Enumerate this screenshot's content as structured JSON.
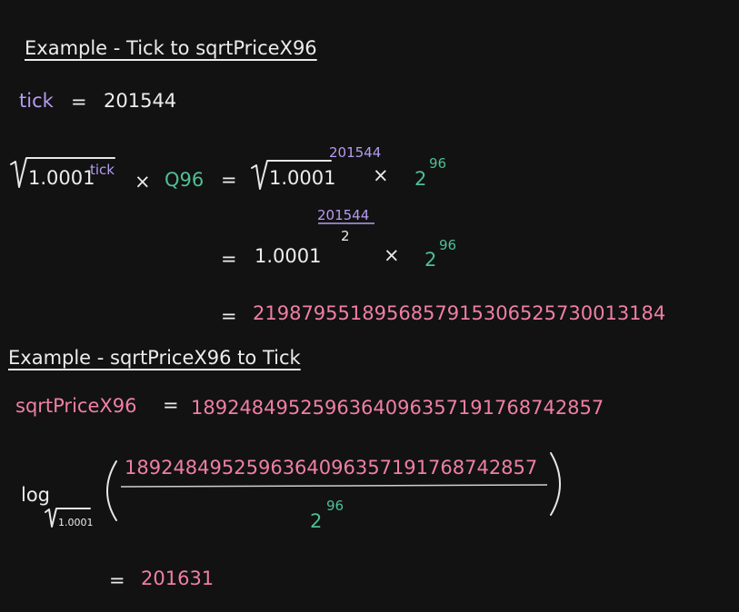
{
  "section1": {
    "heading": "Example - Tick to sqrtPriceX96",
    "tick_label": "tick",
    "tick_eq": "=",
    "tick_value": "201544",
    "row1": {
      "base": "1.0001",
      "exp_tick": "tick",
      "times": "×",
      "q96": "Q96",
      "eq": "=",
      "rhs_base": "1.0001",
      "rhs_exp": "201544",
      "rhs_times": "×",
      "two": "2",
      "two_exp": "96"
    },
    "row2": {
      "eq": "=",
      "base": "1.0001",
      "exp_num": "201544",
      "exp_den": "2",
      "times": "×",
      "two": "2",
      "two_exp": "96"
    },
    "row3": {
      "eq": "=",
      "result": "2198795518956857915306525730013184"
    }
  },
  "section2": {
    "heading": "Example - sqrtPriceX96 to Tick",
    "var_label": "sqrtPriceX96",
    "var_eq": "=",
    "var_value": "1892484952596364096357191768742857",
    "log": {
      "log_label": "log",
      "base": "1.0001",
      "numerator": "1892484952596364096357191768742857",
      "den_base": "2",
      "den_exp": "96"
    },
    "result_eq": "=",
    "result": "201631"
  },
  "colors": {
    "background": "#121212",
    "white_text": "#ececec",
    "purple": "#b59cf0",
    "green": "#4fbf94",
    "pink": "#ef7fa6"
  }
}
